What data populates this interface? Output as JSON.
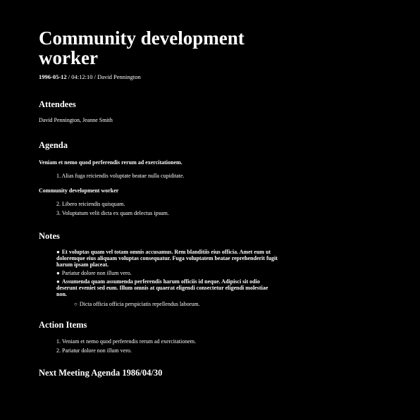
{
  "document": {
    "title": "Community development worker",
    "meta_date": "1996-05-12",
    "meta_rest": " / 04:12:10 / David Pennington"
  },
  "attendees": {
    "heading": "Attendees",
    "names": "David Pennington, Jeanne Smith"
  },
  "agenda": {
    "heading": "Agenda",
    "sections": [
      {
        "title": "Veniam et nemo quod perferendis rerum ad exercitationem.",
        "items": [
          "1. Alias fuga reiciendis voluptate beatae nulla cupiditate."
        ]
      },
      {
        "title": "Community development worker",
        "items": [
          "2. Libero reiciendis quisquam.",
          "3. Voluptatum velit dicta ex quam delectus ipsum."
        ]
      }
    ]
  },
  "notes": {
    "heading": "Notes",
    "bullet_filled": "●",
    "bullet_hollow": "○",
    "items": [
      "Et voluptas quam vel totam omnis accusamus. Rem blanditiis eius officia. Amet eum ut doloremque eius aliquam voluptas consequatur. Fuga voluptatem beatae reprehenderit fugit harum ipsam placeat.",
      "Pariatur dolore non illum vero.",
      "Assumenda quam assumenda perferendis harum officiis id neque. Adipisci sit odio deserunt eveniet sed eum. Illum omnis at quaerat eligendi consectetur eligendi molestiae non."
    ],
    "sub_items": [
      "Dicta officia officia perspiciatis repellendus laborum."
    ]
  },
  "action_items": {
    "heading": "Action Items",
    "items": [
      "1. Veniam et nemo quod perferendis rerum ad exercitationem.",
      "2. Pariatur dolore non illum vero."
    ]
  },
  "next_meeting": {
    "heading": "Next Meeting Agenda 1986/04/30"
  }
}
